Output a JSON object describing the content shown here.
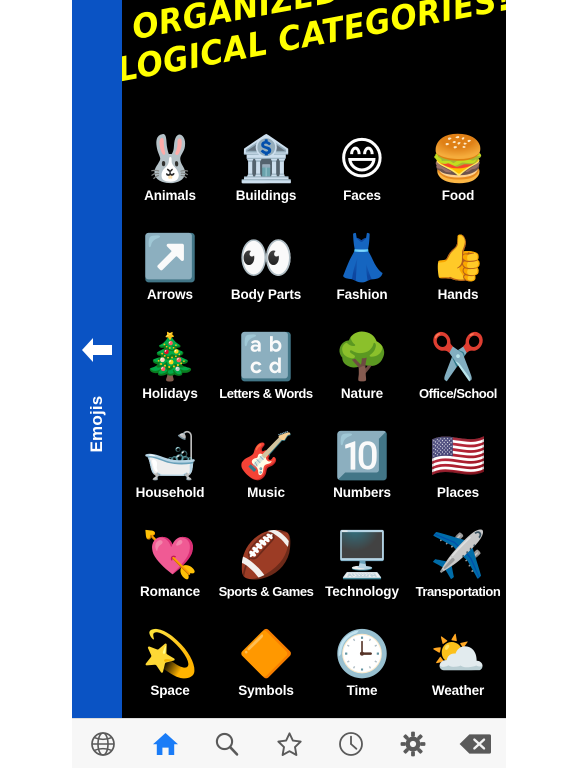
{
  "app": {
    "background_color": "#ffffff",
    "content_background": "#000000",
    "sidebar_color": "#0a53c4",
    "accent_color": "#1a7cf7",
    "banner_color": "#ffff00"
  },
  "sidebar": {
    "back_icon": "left-arrow-icon",
    "label": "Emojis"
  },
  "banner": {
    "line1": "ORGANIZED INTO",
    "line2": "LOGICAL CATEGORIES!"
  },
  "grid": {
    "columns": 4,
    "items": [
      {
        "label": "Animals",
        "emoji": "🐰",
        "icon": "rabbit-face-icon"
      },
      {
        "label": "Buildings",
        "emoji": "🏦",
        "icon": "bank-building-icon"
      },
      {
        "label": "Faces",
        "emoji": "😄",
        "icon": "grinning-face-icon"
      },
      {
        "label": "Food",
        "emoji": "🍔",
        "icon": "hamburger-icon"
      },
      {
        "label": "Arrows",
        "emoji": "↗️",
        "icon": "up-right-arrow-icon"
      },
      {
        "label": "Body Parts",
        "emoji": "👀",
        "icon": "eyes-icon"
      },
      {
        "label": "Fashion",
        "emoji": "👗",
        "icon": "dress-icon"
      },
      {
        "label": "Hands",
        "emoji": "👍",
        "icon": "thumbs-up-icon"
      },
      {
        "label": "Holidays",
        "emoji": "🎄",
        "icon": "christmas-tree-icon"
      },
      {
        "label": "Letters & Words",
        "emoji": "🔡",
        "icon": "abc-input-icon"
      },
      {
        "label": "Nature",
        "emoji": "🌳",
        "icon": "tree-icon"
      },
      {
        "label": "Office/School",
        "emoji": "✂️",
        "icon": "scissors-icon"
      },
      {
        "label": "Household",
        "emoji": "🛁",
        "icon": "bathtub-icon"
      },
      {
        "label": "Music",
        "emoji": "🎸",
        "icon": "guitar-icon"
      },
      {
        "label": "Numbers",
        "emoji": "🔟",
        "icon": "keycap-ten-icon"
      },
      {
        "label": "Places",
        "emoji": "🇺🇸",
        "icon": "us-flag-icon"
      },
      {
        "label": "Romance",
        "emoji": "💘",
        "icon": "heart-with-arrow-icon"
      },
      {
        "label": "Sports & Games",
        "emoji": "🏈",
        "icon": "football-icon"
      },
      {
        "label": "Technology",
        "emoji": "🖥️",
        "icon": "desktop-computer-icon"
      },
      {
        "label": "Transportation",
        "emoji": "✈️",
        "icon": "airplane-icon"
      },
      {
        "label": "Space",
        "emoji": "💫",
        "icon": "dizzy-star-icon"
      },
      {
        "label": "Symbols",
        "emoji": "🔶",
        "icon": "orange-diamond-icon"
      },
      {
        "label": "Time",
        "emoji": "🕒",
        "icon": "clock-icon"
      },
      {
        "label": "Weather",
        "emoji": "⛅",
        "icon": "sun-behind-cloud-icon"
      }
    ]
  },
  "toolbar": {
    "items": [
      {
        "icon": "globe-icon",
        "name": "browse",
        "active": false
      },
      {
        "icon": "home-icon",
        "name": "home",
        "active": true
      },
      {
        "icon": "search-icon",
        "name": "search",
        "active": false
      },
      {
        "icon": "star-icon",
        "name": "favorites",
        "active": false
      },
      {
        "icon": "clock-icon",
        "name": "recents",
        "active": false
      },
      {
        "icon": "gear-icon",
        "name": "settings",
        "active": false
      },
      {
        "icon": "backspace-icon",
        "name": "delete",
        "active": false
      }
    ]
  }
}
